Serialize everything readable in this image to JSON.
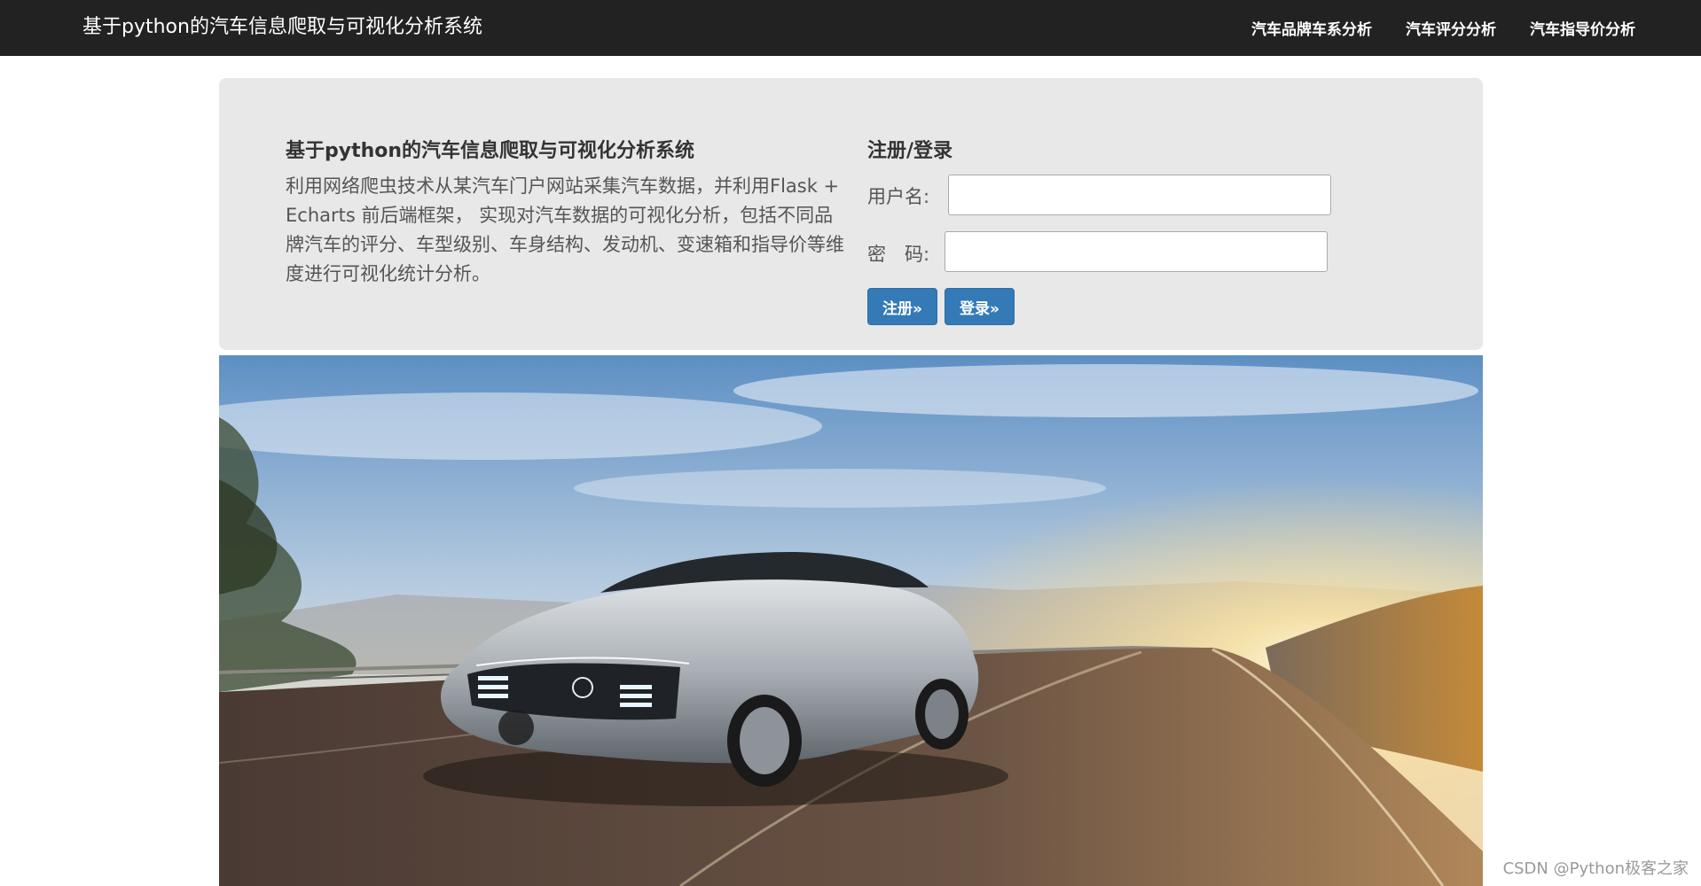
{
  "navbar": {
    "brand": "基于python的汽车信息爬取与可视化分析系统",
    "links": [
      {
        "label": "汽车品牌车系分析"
      },
      {
        "label": "汽车评分分析"
      },
      {
        "label": "汽车指导价分析"
      }
    ]
  },
  "intro": {
    "title": "基于python的汽车信息爬取与可视化分析系统",
    "description": "利用网络爬虫技术从某汽车门户网站采集汽车数据，并利用Flask + Echarts 前后端框架， 实现对汽车数据的可视化分析，包括不同品牌汽车的评分、车型级别、车身结构、发动机、变速箱和指导价等维度进行可视化统计分析。"
  },
  "auth": {
    "title": "注册/登录",
    "username_label": "用户名:",
    "username_value": "",
    "password_label": "密　码:",
    "password_value": "",
    "register_button": "注册»",
    "login_button": "登录»"
  },
  "hero": {
    "icon": "car-photo-icon"
  },
  "watermark": "CSDN @Python极客之家"
}
